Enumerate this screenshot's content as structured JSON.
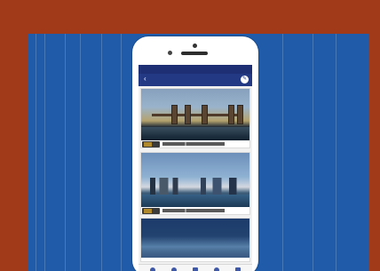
{
  "mockup": {
    "background_color": "#a13a18",
    "panel_color": "#1f5ba8",
    "device": "phone"
  },
  "app": {
    "status_bar": {
      "carrier": "",
      "time": "",
      "battery": ""
    },
    "header": {
      "back_icon": "chevron-left-icon",
      "title": "",
      "action_icon": "edit-icon"
    },
    "cards": [
      {
        "image": "bridge-city-dusk-photo",
        "caption": ""
      },
      {
        "image": "skyline-water-photo",
        "caption": ""
      },
      {
        "image": "night-city-photo",
        "caption": ""
      }
    ],
    "tab_bar": [
      {
        "icon": "home-icon"
      },
      {
        "icon": "list-icon"
      },
      {
        "icon": "grid-icon"
      },
      {
        "icon": "map-icon"
      },
      {
        "icon": "profile-icon"
      }
    ]
  }
}
